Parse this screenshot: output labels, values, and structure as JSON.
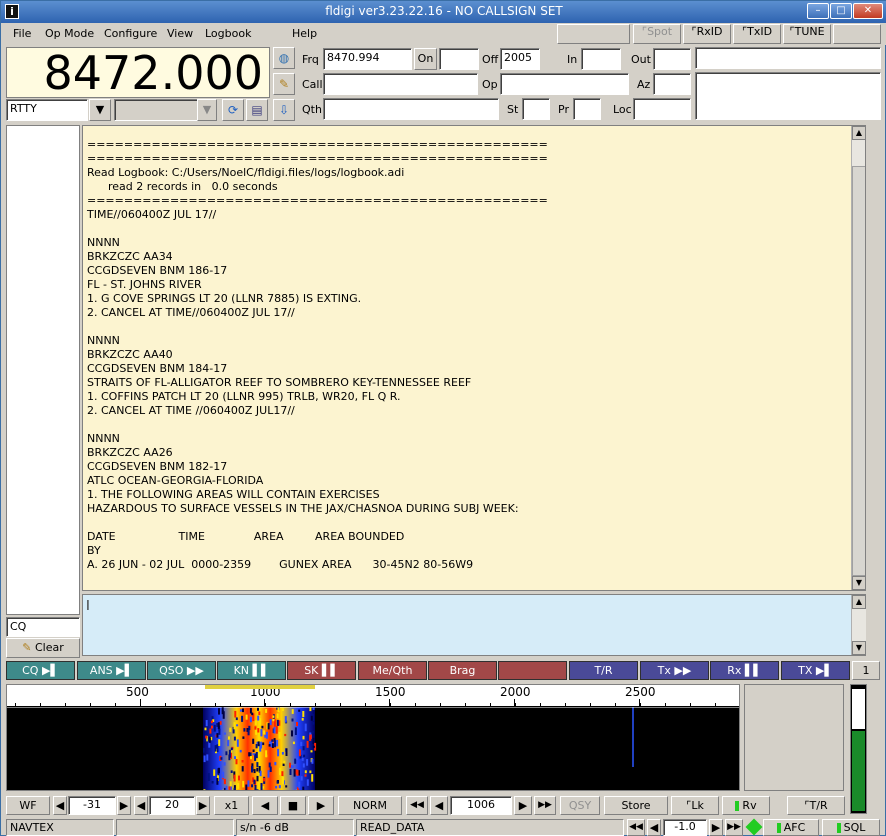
{
  "titlebar": {
    "title": "fldigi ver3.23.22.16 - NO CALLSIGN SET",
    "app_icon": "i",
    "minimize": "–",
    "maximize": "□",
    "close": "✕"
  },
  "menu": {
    "file": "File",
    "opmode": "Op Mode",
    "configure": "Configure",
    "view": "View",
    "logbook": "Logbook",
    "help": "Help"
  },
  "toprow": {
    "spot": "Spot",
    "rxid": "RxID",
    "txid": "TxID",
    "tune": "TUNE"
  },
  "freq_display": "8472.000",
  "mode": {
    "value": "RTTY",
    "arrow": "▼"
  },
  "log": {
    "frq_label": "Frq",
    "frq_value": "8470.994",
    "on_label": "On",
    "on_value": "",
    "off_label": "Off",
    "off_value": "2005",
    "in_label": "In",
    "in_value": "",
    "out_label": "Out",
    "out_value": "",
    "call_label": "Call",
    "call_value": "",
    "op_label": "Op",
    "op_value": "",
    "az_label": "Az",
    "az_value": "",
    "qth_label": "Qth",
    "qth_value": "",
    "st_label": "St",
    "st_value": "",
    "pr_label": "Pr",
    "pr_value": "",
    "loc_label": "Loc",
    "loc_value": ""
  },
  "rx_text": "==================================================\n==================================================\nRead Logbook: C:/Users/NoelC/fldigi.files/logs/logbook.adi\n      read 2 records in   0.0 seconds\n==================================================\nTIME//060400Z JUL 17//\n\nNNNN\nBRKZCZC AA34\nCCGDSEVEN BNM 186-17\nFL - ST. JOHNS RIVER\n1. G COVE SPRINGS LT 20 (LLNR 7885) IS EXTING.\n2. CANCEL AT TIME//060400Z JUL 17//\n\nNNNN\nBRKZCZC AA40\nCCGDSEVEN BNM 184-17\nSTRAITS OF FL-ALLIGATOR REEF TO SOMBRERO KEY-TENNESSEE REEF\n1. COFFINS PATCH LT 20 (LLNR 995) TRLB, WR20, FL Q R.\n2. CANCEL AT TIME //060400Z JUL17//\n\nNNNN\nBRKZCZC AA26\nCCGDSEVEN BNM 182-17\nATLC OCEAN-GEORGIA-FLORIDA\n1. THE FOLLOWING AREAS WILL CONTAIN EXERCISES\nHAZARDOUS TO SURFACE VESSELS IN THE JAX/CHASNOA DURING SUBJ WEEK:\n\nDATE                  TIME              AREA         AREA BOUNDED\nBY\nA. 26 JUN - 02 JUL  0000-2359        GUNEX AREA      30-45N2 80-56W9",
  "tx_cursor": "I",
  "left": {
    "cq": "CQ",
    "clear": "Clear"
  },
  "macros": [
    {
      "label": "CQ ▶▌",
      "color": "#3e8a8a"
    },
    {
      "label": "ANS ▶▌",
      "color": "#3e8a8a"
    },
    {
      "label": "QSO ▶▶",
      "color": "#3e8a8a"
    },
    {
      "label": "KN ▌▌",
      "color": "#3e8a8a"
    },
    {
      "label": "SK ▌▌",
      "color": "#a24848"
    },
    {
      "label": "Me/Qth",
      "color": "#a24848"
    },
    {
      "label": "Brag",
      "color": "#a24848"
    },
    {
      "label": "",
      "color": "#a24848"
    },
    {
      "label": "T/R",
      "color": "#4a4a98"
    },
    {
      "label": "Tx ▶▶",
      "color": "#4a4a98"
    },
    {
      "label": "Rx ▌▌",
      "color": "#4a4a98"
    },
    {
      "label": "TX ▶▌",
      "color": "#4a4a98"
    }
  ],
  "macro_page": "1",
  "waterfall": {
    "ticks": [
      "500",
      "1000",
      "1500",
      "2000",
      "2500"
    ]
  },
  "wfbar": {
    "wf": "WF",
    "lo": "-31",
    "hi": "20",
    "zoom": "x1",
    "speed": "NORM",
    "freq": "1006",
    "qsy": "QSY",
    "store": "Store",
    "lk": "Lk",
    "rv": "Rv",
    "tr": "T/R"
  },
  "status": {
    "mode": "NAVTEX",
    "sn": "s/n  -6 dB",
    "state": "READ_DATA",
    "afc_offset": "-1.0",
    "afc": "AFC",
    "sql": "SQL"
  }
}
